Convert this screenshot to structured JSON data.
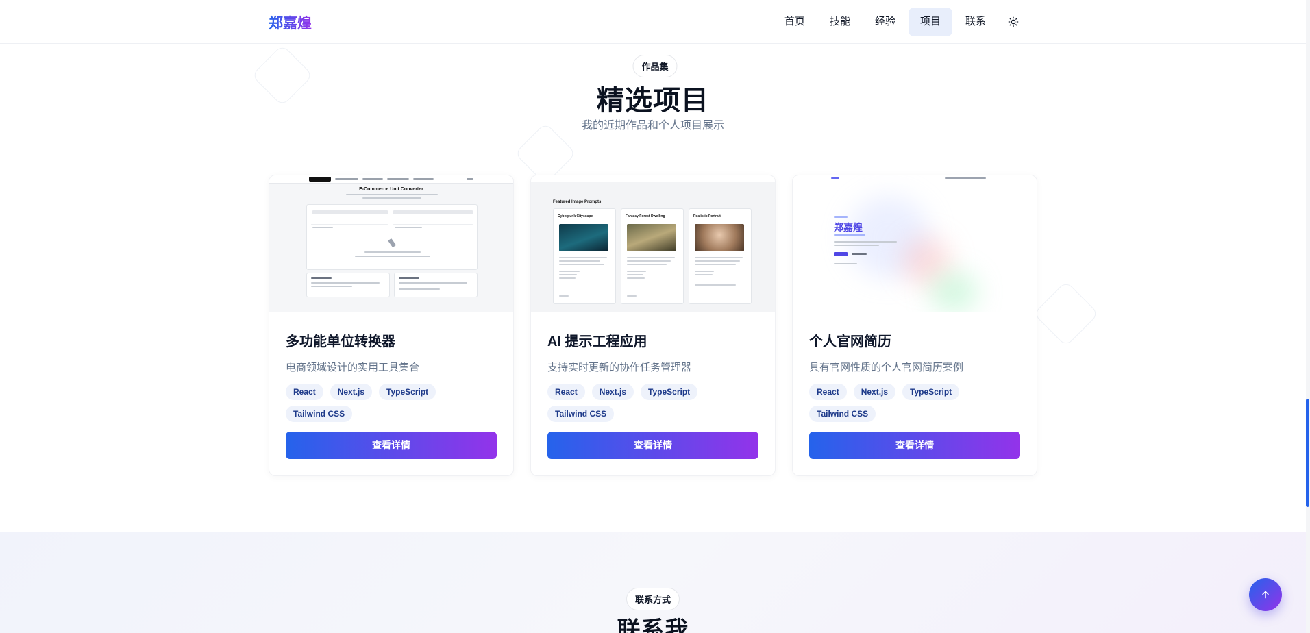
{
  "header": {
    "logo": "郑嘉煌",
    "nav": [
      {
        "label": "首页",
        "active": false
      },
      {
        "label": "技能",
        "active": false
      },
      {
        "label": "经验",
        "active": false
      },
      {
        "label": "项目",
        "active": true
      },
      {
        "label": "联系",
        "active": false
      }
    ],
    "theme_icon": "sun-icon"
  },
  "projects": {
    "badge": "作品集",
    "title": "精选项目",
    "subtitle": "我的近期作品和个人项目展示",
    "cards": [
      {
        "title": "多功能单位转换器",
        "description": "电商领域设计的实用工具集合",
        "tags": [
          "React",
          "Next.js",
          "TypeScript",
          "Tailwind CSS"
        ],
        "button": "查看详情",
        "thumb_heading": "E-Commerce Unit Converter"
      },
      {
        "title": "AI 提示工程应用",
        "description": "支持实时更新的协作任务管理器",
        "tags": [
          "React",
          "Next.js",
          "TypeScript",
          "Tailwind CSS"
        ],
        "button": "查看详情",
        "thumb_heading": "Featured Image Prompts",
        "thumb_cards": [
          "Cyberpunk Cityscape",
          "Fantasy Forest Dwelling",
          "Realistic Portrait"
        ]
      },
      {
        "title": "个人官网简历",
        "description": "具有官网性质的个人官网简历案例",
        "tags": [
          "React",
          "Next.js",
          "TypeScript",
          "Tailwind CSS"
        ],
        "button": "查看详情",
        "thumb_name": "郑嘉煌"
      }
    ]
  },
  "contact": {
    "badge": "联系方式",
    "title": "联系我"
  },
  "back_to_top_icon": "arrow-up-icon",
  "colors": {
    "accent_start": "#2563eb",
    "accent_end": "#9333ea",
    "tag_bg": "#eef2fb",
    "tag_text": "#1e3a8a"
  }
}
